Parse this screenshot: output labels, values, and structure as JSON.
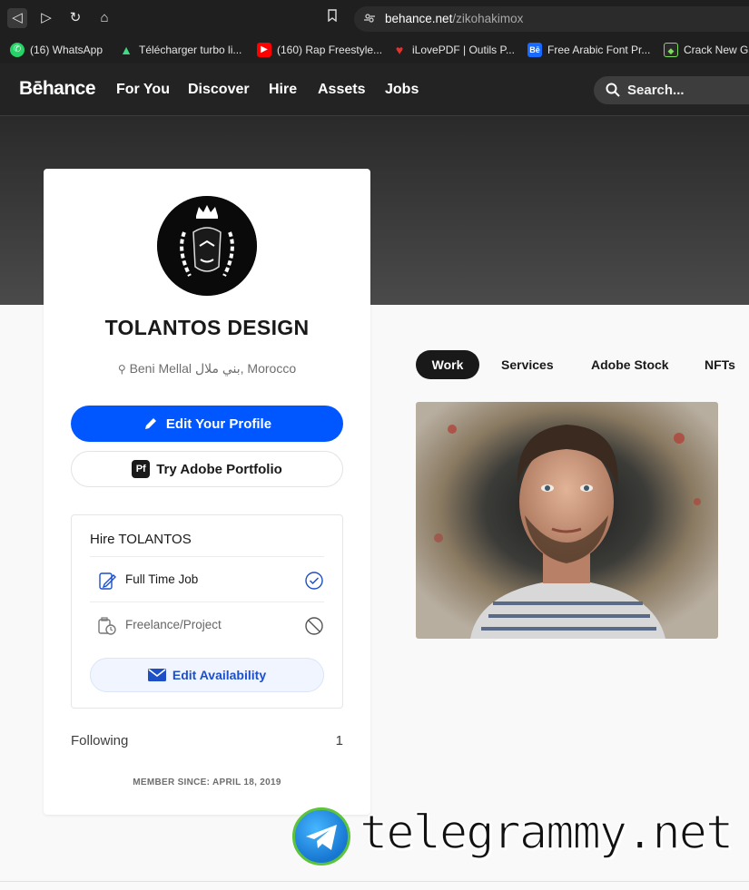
{
  "browser": {
    "url_host": "behance.net",
    "url_path": "/zikohakimox",
    "bookmarks": [
      {
        "label": "(16) WhatsApp",
        "icon": "whatsapp-icon",
        "color": "#25d366"
      },
      {
        "label": "Télécharger turbo li...",
        "icon": "android-icon",
        "color": "#3ddc84"
      },
      {
        "label": "(160) Rap Freestyle...",
        "icon": "youtube-icon",
        "color": "#ff0000"
      },
      {
        "label": "iLovePDF | Outils P...",
        "icon": "heart-icon",
        "color": "#e5322d"
      },
      {
        "label": "Free Arabic Font Pr...",
        "icon": "behance-icon",
        "color": "#1769ff"
      },
      {
        "label": "Crack New Ga",
        "icon": "shield-icon",
        "color": "#2a2a2a"
      }
    ]
  },
  "header": {
    "logo": "Bēhance",
    "nav": [
      "For You",
      "Discover",
      "Hire",
      "Assets",
      "Jobs"
    ],
    "search_placeholder": "Search..."
  },
  "profile": {
    "name": "TOLANTOS DESIGN",
    "location": "Beni Mellal بني ملال, Morocco",
    "edit_button": "Edit Your Profile",
    "portfolio_icon": "Pf",
    "portfolio_button": "Try Adobe Portfolio",
    "hire_title": "Hire TOLANTOS",
    "hire_options": [
      {
        "label": "Full Time Job",
        "status": "available"
      },
      {
        "label": "Freelance/Project",
        "status": "unavailable"
      }
    ],
    "availability_button": "Edit Availability",
    "following_label": "Following",
    "following_count": "1",
    "member_since": "MEMBER SINCE: APRIL 18, 2019"
  },
  "tabs": [
    "Work",
    "Services",
    "Adobe Stock",
    "NFTs"
  ],
  "active_tab": "Work",
  "watermark": "telegrammy.net",
  "colors": {
    "accent": "#0057ff",
    "header_bg": "#232323",
    "avail_text": "#1d4fc9"
  }
}
